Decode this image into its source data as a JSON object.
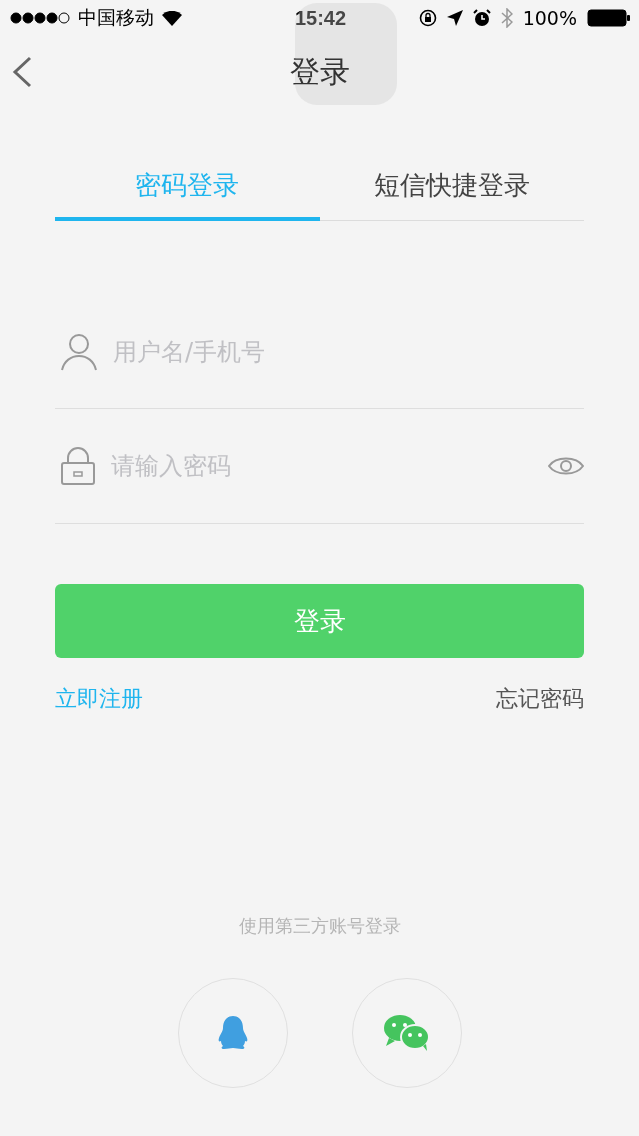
{
  "status_bar": {
    "carrier": "中国移动",
    "time": "15:42",
    "battery": "100%"
  },
  "nav": {
    "title": "登录"
  },
  "tabs": [
    {
      "label": "密码登录",
      "selected": true
    },
    {
      "label": "短信快捷登录",
      "selected": false
    }
  ],
  "fields": [
    {
      "kind": "username",
      "placeholder": "用户名/手机号"
    },
    {
      "kind": "password",
      "placeholder": "请输入密码"
    }
  ],
  "login_button": "登录",
  "links": {
    "register": "立即注册",
    "forgot": "忘记密码"
  },
  "third_party": {
    "caption": "使用第三方账号登录",
    "buttons": [
      {
        "kind": "penguin"
      },
      {
        "kind": "chat"
      }
    ]
  }
}
